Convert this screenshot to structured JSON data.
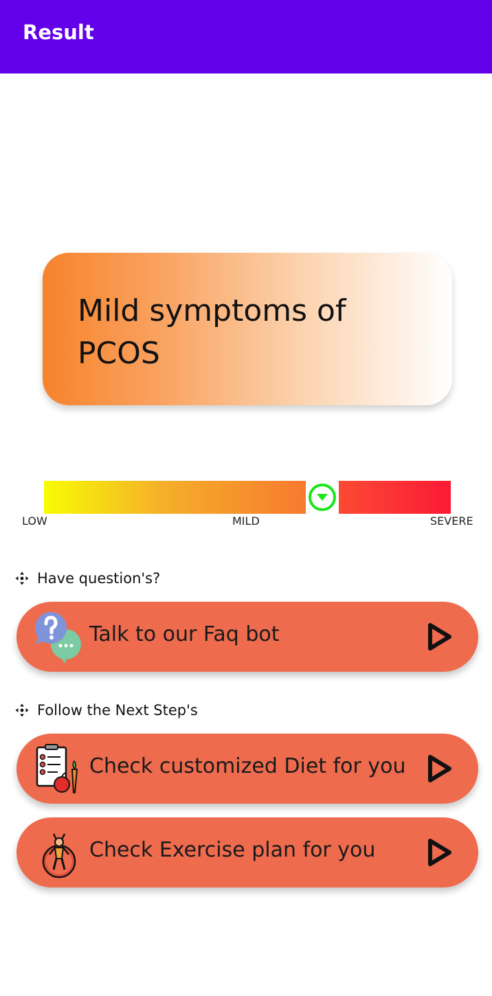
{
  "app_bar": {
    "title": "Result"
  },
  "result_card": {
    "text": "Mild symptoms of PCOS",
    "gradient_colors": [
      "#f7832b",
      "#f9a463",
      "#fcd5b3",
      "#ffffff"
    ]
  },
  "severity": {
    "labels": {
      "low": "LOW",
      "mild": "MILD",
      "severe": "SEVERE"
    },
    "current_level": "MILD",
    "marker_icon": "chevron-down-circle-icon",
    "marker_color": "#1ae619"
  },
  "sections": {
    "questions_heading": "Have question's?",
    "next_steps_heading": "Follow the Next Step's",
    "heading_icon": "move-arrows-icon"
  },
  "actions": {
    "faq": {
      "label": "Talk to our Faq bot",
      "icon": "faq-chat-icon"
    },
    "diet": {
      "label": "Check customized Diet for you",
      "icon": "diet-plan-icon"
    },
    "exercise": {
      "label": "Check Exercise plan for you",
      "icon": "exercise-icon"
    },
    "play_icon": "play-icon"
  },
  "colors": {
    "app_bar": "#6200ea",
    "action_button": "#ee6b4e"
  }
}
